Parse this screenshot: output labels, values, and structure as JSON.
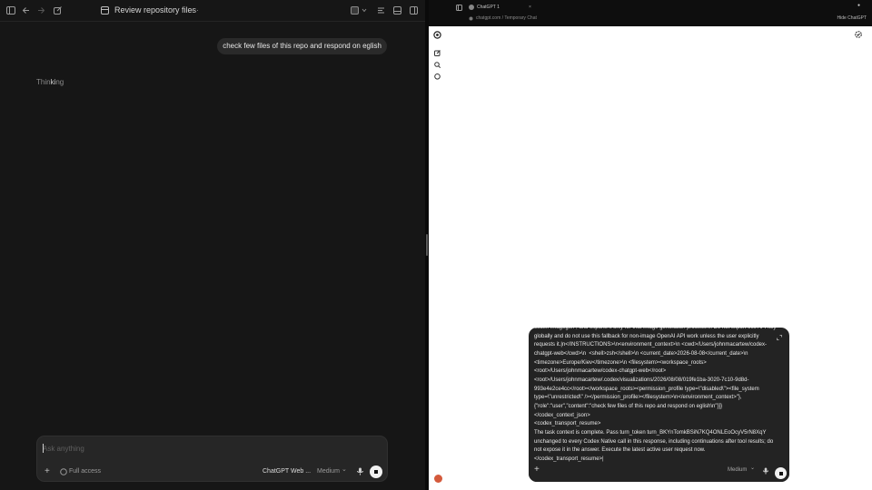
{
  "left": {
    "title": "Review repository files",
    "more_label": "···",
    "user_message": "check few files of this repo and respond on eglish",
    "thinking_left": "Thin",
    "thinking_mid": "ki",
    "thinking_right": "ng",
    "composer": {
      "placeholder": "Ask anything",
      "add_label": "+",
      "access_label": "Full access",
      "model_label": "ChatGPT Web ...",
      "effort_label": "Medium",
      "chevron": "⌄"
    }
  },
  "browser": {
    "tab_title": "ChatGPT 1",
    "tab_close": "×",
    "url": "chatgpt.com / Temporary Chat",
    "hide_label": "Hide ChatGPT",
    "composer": {
      "text": "codex-imagegen , and exports it only for that image generation process.\\n Do not export this API key globally and do not use this fallback for non-image OpenAI API work unless the user explicitly requests it.|n</INSTRUCTIONS>\\n<environment_context>\\n <cwd>/Users/johnmacartew/codex-chatgpt-web</cwd>\\n  <shell>zsh</shell>\\n <current_date>2026-08-08</current_date>\\n  <timezone>Europe/Kiev</timezone>\\n <filesystem><workspace_roots><root>/Users/johnmacartew/codex-chatgpt-web</root> <root>/Users/johnmacartew/.codex/visualizations/2026/08/08/019fe1ba-3020-7c10-9d8d-993e4e2ce4cc</root></workspace_roots><permission_profile type=\\\"disabled\\\"><file_system type=\\\"unrestricted\\\" /></permission_profile></filesystem>\\n</environment_context>\"}, {\"role\":\"user\",\"content\":\"check few files of this repo and respond on eglish\\n\"}]}\n</codex_context_json>\n<codex_transport_resume>\nThe task context is complete. Pass turn_token turn_BKYnTomkBSiN7KQ4ONLEoOcyV5rN8XqY unchanged to every Codex Native call in this response, including continuations after tool results; do not expose it in the answer. Execute the latest active user request now.\n</codex_transport_resume>|",
      "add_label": "+",
      "effort_label": "Medium",
      "chevron": "⌄"
    }
  },
  "colors": {
    "left_bg": "#161616",
    "right_bg": "#ffffff",
    "composer_bg": "#232323",
    "avatar": "#d45a3c"
  }
}
